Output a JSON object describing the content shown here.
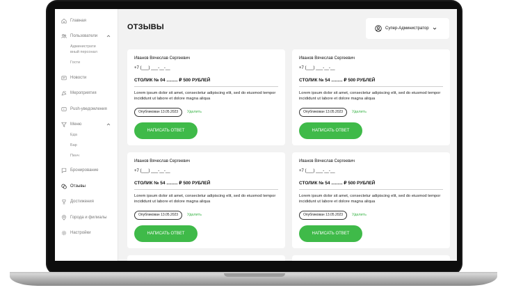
{
  "sidebar": {
    "items": [
      {
        "label": "Главная",
        "icon": "home-icon"
      },
      {
        "label": "Пользователи",
        "icon": "users-icon"
      },
      {
        "label": "Новости",
        "icon": "news-icon"
      },
      {
        "label": "Мероприятия",
        "icon": "event-icon"
      },
      {
        "label": "Push-уведомления",
        "icon": "push-icon"
      },
      {
        "label": "Меню",
        "icon": "filter-icon"
      },
      {
        "label": "Бронирование",
        "icon": "booking-icon"
      },
      {
        "label": "Отзывы",
        "icon": "reviews-icon"
      },
      {
        "label": "Достижения",
        "icon": "trophy-icon"
      },
      {
        "label": "Города и филиалы",
        "icon": "location-icon"
      },
      {
        "label": "Настройки",
        "icon": "settings-icon"
      }
    ],
    "users_sub": [
      "Администрати",
      "вный персонал",
      "Гости"
    ],
    "menu_sub": [
      "Еда",
      "Бар",
      "Пенч"
    ]
  },
  "header": {
    "title": "ОТЗЫВЫ",
    "user_role": "Супер-Администратор"
  },
  "reviews": [
    {
      "name": "Иванов Вячеслав Сергеевич",
      "phone": "+7 (___) ___-__-__",
      "table": "СТОЛИК № 04 ......... ₽ 500 РУБЛЕЙ",
      "text": "Lorem ipsum dolor sit amet, consectetur adipiscing elit, sed do eiusmod tempor incididunt ut labore et dolore magna aliqua",
      "published": "Опубликован 13.05.2023",
      "delete": "Удалить",
      "reply": "НАПИСАТЬ ОТВЕТ"
    },
    {
      "name": "Иванов Вячеслав Сергеевич",
      "phone": "+7 (___) ___-__-__",
      "table": "СТОЛИК № 54 ......... ₽ 500 РУБЛЕЙ",
      "text": "Lorem ipsum dolor sit amet, consectetur adipiscing elit, sed do eiusmod tempor incididunt ut labore et dolore magna aliqua",
      "published": "Опубликован 13.05.2023",
      "delete": "Удалить",
      "reply": "НАПИСАТЬ ОТВЕТ"
    },
    {
      "name": "Иванов Вячеслав Сергеевич",
      "phone": "+7 (___) ___-__-__",
      "table": "СТОЛИК № 54 ......... ₽ 500 РУБЛЕЙ",
      "text": "Lorem ipsum dolor sit amet, consectetur adipiscing elit, sed do eiusmod tempor incididunt ut labore et dolore magna aliqua",
      "published": "Опубликован 13.05.2023",
      "delete": "Удалить",
      "reply": "НАПИСАТЬ ОТВЕТ"
    },
    {
      "name": "Иванов Вячеслав Сергеевич",
      "phone": "+7 (___) ___-__-__",
      "table": "СТОЛИК № 54 ......... ₽ 500 РУБЛЕЙ",
      "text": "Lorem ipsum dolor sit amet, consectetur adipiscing elit, sed do eiusmod tempor incididunt ut labore et dolore magna aliqua",
      "published": "Опубликован 13.05.2023",
      "delete": "Удалить",
      "reply": "НАПИСАТЬ ОТВЕТ"
    }
  ],
  "colors": {
    "accent": "#3fba49",
    "background": "#f2f2f2"
  }
}
